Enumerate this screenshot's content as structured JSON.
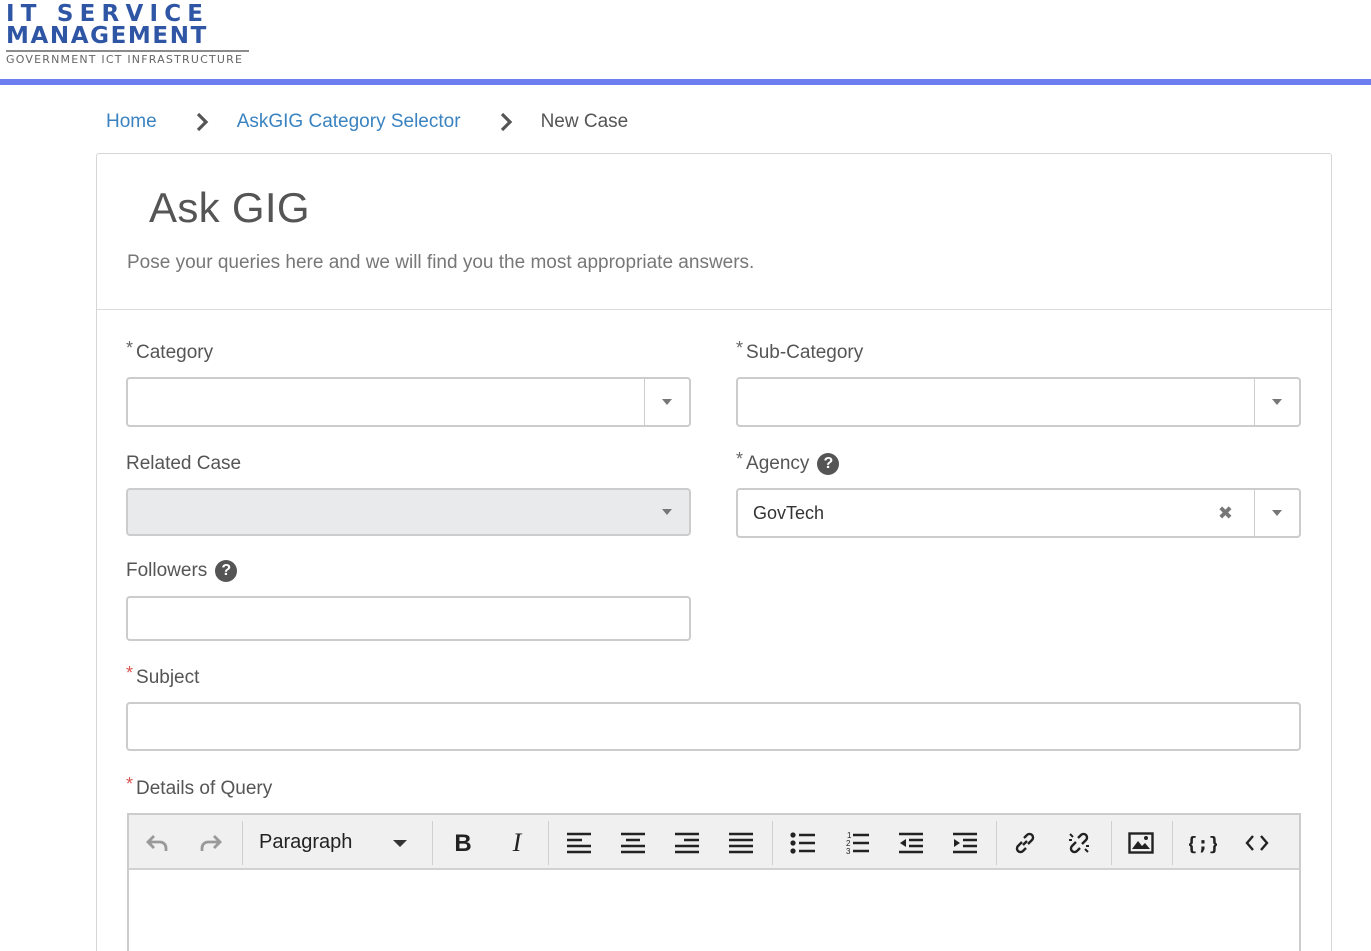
{
  "header": {
    "logo_line1": "IT SERVICE",
    "logo_line2": "MANAGEMENT",
    "logo_sub": "GOVERNMENT ICT INFRASTRUCTURE",
    "brand_color": "#2f56a5",
    "bar_color": "#6d7ff0"
  },
  "breadcrumb": {
    "items": [
      {
        "label": "Home"
      },
      {
        "label": "AskGIG Category Selector"
      },
      {
        "label": "New Case"
      }
    ],
    "separator_icon": "chevron-right-icon"
  },
  "page": {
    "title": "Ask GIG",
    "subtitle": "Pose your queries here and we will find you the most appropriate answers."
  },
  "form": {
    "required_mark": "*",
    "category": {
      "label": "Category",
      "value": ""
    },
    "sub_category": {
      "label": "Sub-Category",
      "value": ""
    },
    "related_case": {
      "label": "Related Case",
      "value": ""
    },
    "agency": {
      "label": "Agency",
      "value": "GovTech",
      "clear": "✖"
    },
    "followers": {
      "label": "Followers",
      "value": ""
    },
    "subject": {
      "label": "Subject",
      "value": ""
    },
    "details": {
      "label": "Details of Query"
    },
    "help_icon": "?",
    "required_colors": {
      "grey": "#666666",
      "red": "#d9534f"
    }
  },
  "editor": {
    "block_format": "Paragraph",
    "tools": [
      "undo-icon",
      "redo-icon",
      "bold-icon",
      "italic-icon",
      "align-left-icon",
      "align-center-icon",
      "align-right-icon",
      "align-justify-icon",
      "bullet-list-icon",
      "numbered-list-icon",
      "outdent-icon",
      "indent-icon",
      "link-icon",
      "unlink-icon",
      "image-icon",
      "code-sample-icon",
      "source-code-icon"
    ],
    "content": ""
  }
}
